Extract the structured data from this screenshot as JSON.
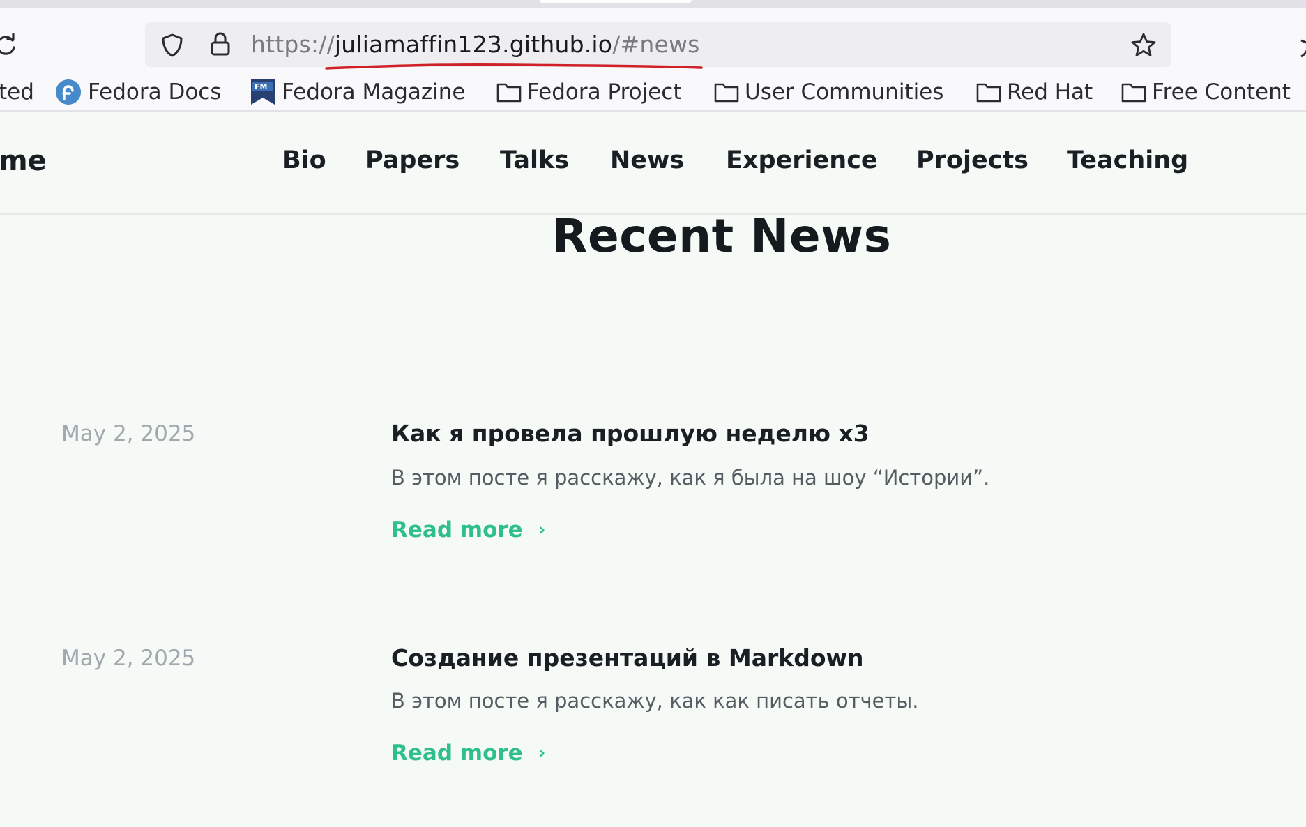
{
  "browser": {
    "url_scheme": "https://",
    "url_host": "juliamaffin123.github.io",
    "url_path": "/#news",
    "bookmarks": [
      {
        "label": "ted",
        "icon": "none"
      },
      {
        "label": "Fedora Docs",
        "icon": "fedora-icon"
      },
      {
        "label": "Fedora Magazine",
        "icon": "fedora-magazine-icon"
      },
      {
        "label": "Fedora Project",
        "icon": "folder-icon"
      },
      {
        "label": "User Communities",
        "icon": "folder-icon"
      },
      {
        "label": "Red Hat",
        "icon": "folder-icon"
      },
      {
        "label": "Free Content",
        "icon": "folder-icon"
      }
    ]
  },
  "site": {
    "brand": "me",
    "nav": [
      "Bio",
      "Papers",
      "Talks",
      "News",
      "Experience",
      "Projects",
      "Teaching"
    ]
  },
  "news": {
    "title": "Recent News",
    "posts": [
      {
        "date": "May 2, 2025",
        "title": "Как я провела прошлую неделю x3",
        "excerpt": "В этом посте я расскажу, как я была на шоу “Истории”.",
        "link": "Read more",
        "chevron": "›"
      },
      {
        "date": "May 2, 2025",
        "title": "Создание презентаций в Markdown",
        "excerpt": "В этом посте я расскажу, как как писать отчеты.",
        "link": "Read more",
        "chevron": "›"
      }
    ]
  },
  "colors": {
    "accent": "#2fbf88",
    "annotation": "#d0212a",
    "page_background": "#f6faf7"
  }
}
